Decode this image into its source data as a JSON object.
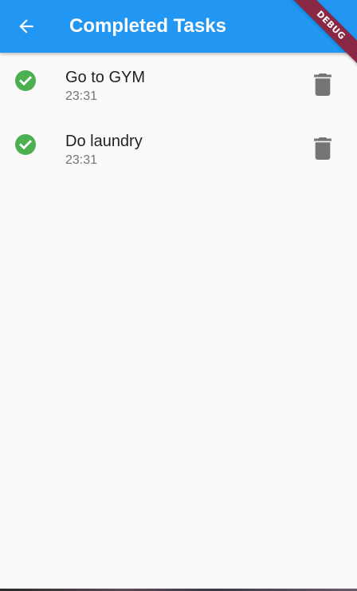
{
  "app_bar": {
    "title": "Completed Tasks",
    "back_icon": "arrow-back-icon",
    "background_color": "#2196f3"
  },
  "debug_banner": {
    "label": "DEBUG",
    "color": "#8a2742"
  },
  "tasks": [
    {
      "title": "Go to GYM",
      "time": "23:31",
      "status_icon": "check-circle-icon",
      "action_icon": "trash-icon"
    },
    {
      "title": "Do laundry",
      "time": "23:31",
      "status_icon": "check-circle-icon",
      "action_icon": "trash-icon"
    }
  ],
  "colors": {
    "check": "#4caf50",
    "delete_icon": "#757575",
    "background": "#fafafa"
  }
}
